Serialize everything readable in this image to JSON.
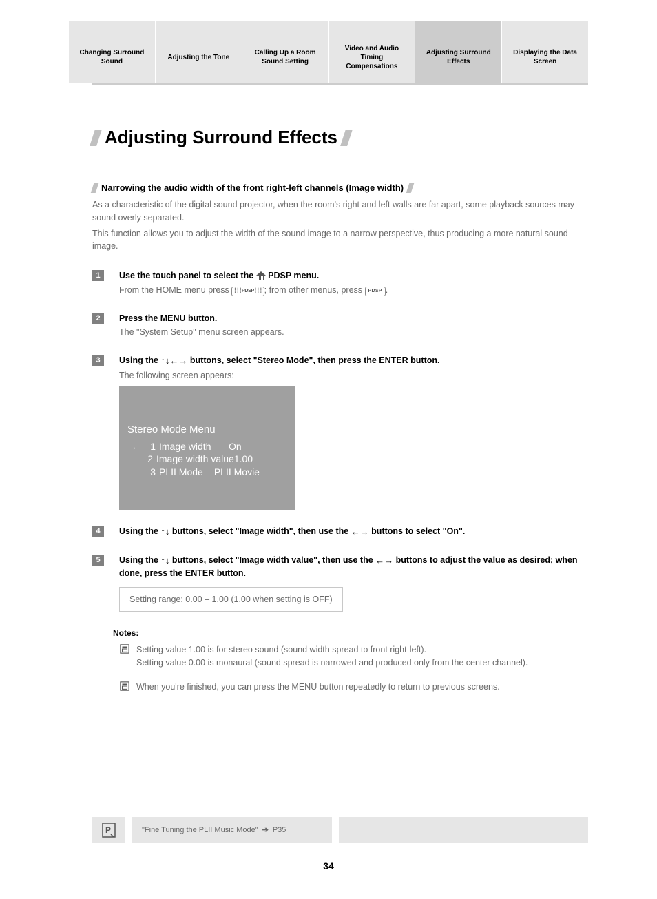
{
  "tabs": [
    {
      "label": "Changing Surround Sound"
    },
    {
      "label": "Adjusting the Tone"
    },
    {
      "label": "Calling Up a Room Sound Setting"
    },
    {
      "label": "Video and Audio Timing Compensations"
    },
    {
      "label": "Adjusting Surround Effects",
      "active": true
    },
    {
      "label": "Displaying the Data Screen"
    }
  ],
  "page_title": "Adjusting Surround Effects",
  "sub_heading": "Narrowing the audio width of the front right-left channels (Image width)",
  "intro": {
    "p1": "As a characteristic of the digital sound projector, when the room's right and left walls are far apart, some playback sources may sound overly separated.",
    "p2": "This function allows you to adjust the width of the sound image to a narrow perspective, thus producing a more natural sound image."
  },
  "steps": {
    "s1": {
      "title_a": "Use the touch panel to select the ",
      "title_b": " PDSP menu.",
      "desc_a": "From the HOME menu press ",
      "desc_b": "; from other menus, press ",
      "desc_c": ".",
      "btn_wide": "PDSP",
      "btn_small": "PDSP"
    },
    "s2": {
      "title": "Press the MENU button.",
      "desc": "The \"System Setup\" menu screen appears."
    },
    "s3": {
      "title_a": "Using the ",
      "title_b": " buttons, select \"Stereo Mode\", then press the ENTER button.",
      "desc": "The following screen appears:"
    },
    "s4": {
      "title_a": "Using the ",
      "title_b": " buttons, select \"Image width\", then use the ",
      "title_c": " buttons to select \"On\"."
    },
    "s5": {
      "title_a": "Using the ",
      "title_b": " buttons, select \"Image width value\", then use the ",
      "title_c": " buttons to adjust the value as desired; when done, press the ENTER button."
    }
  },
  "osd": {
    "title": "Stereo Mode Menu",
    "row1": {
      "num": "1",
      "label": "Image width",
      "val": "On"
    },
    "row2": {
      "num": "2",
      "label": "Image width value",
      "val": "1.00"
    },
    "row3": {
      "num": "3",
      "label": "PLII Mode",
      "val": "PLII Movie"
    }
  },
  "setting_range": "Setting range: 0.00 – 1.00 (1.00 when setting is OFF)",
  "notes": {
    "heading": "Notes:",
    "n1a": "Setting value 1.00 is for stereo sound (sound width spread to front right-left).",
    "n1b": "Setting value 0.00 is monaural (sound spread is narrowed and produced only from the center channel).",
    "n2": "When you're finished, you can press the MENU button repeatedly to return to previous screens."
  },
  "footer_ref": {
    "text": "\"Fine Tuning the PLII Music Mode\"",
    "page_ref": "P35"
  },
  "page_number": "34"
}
